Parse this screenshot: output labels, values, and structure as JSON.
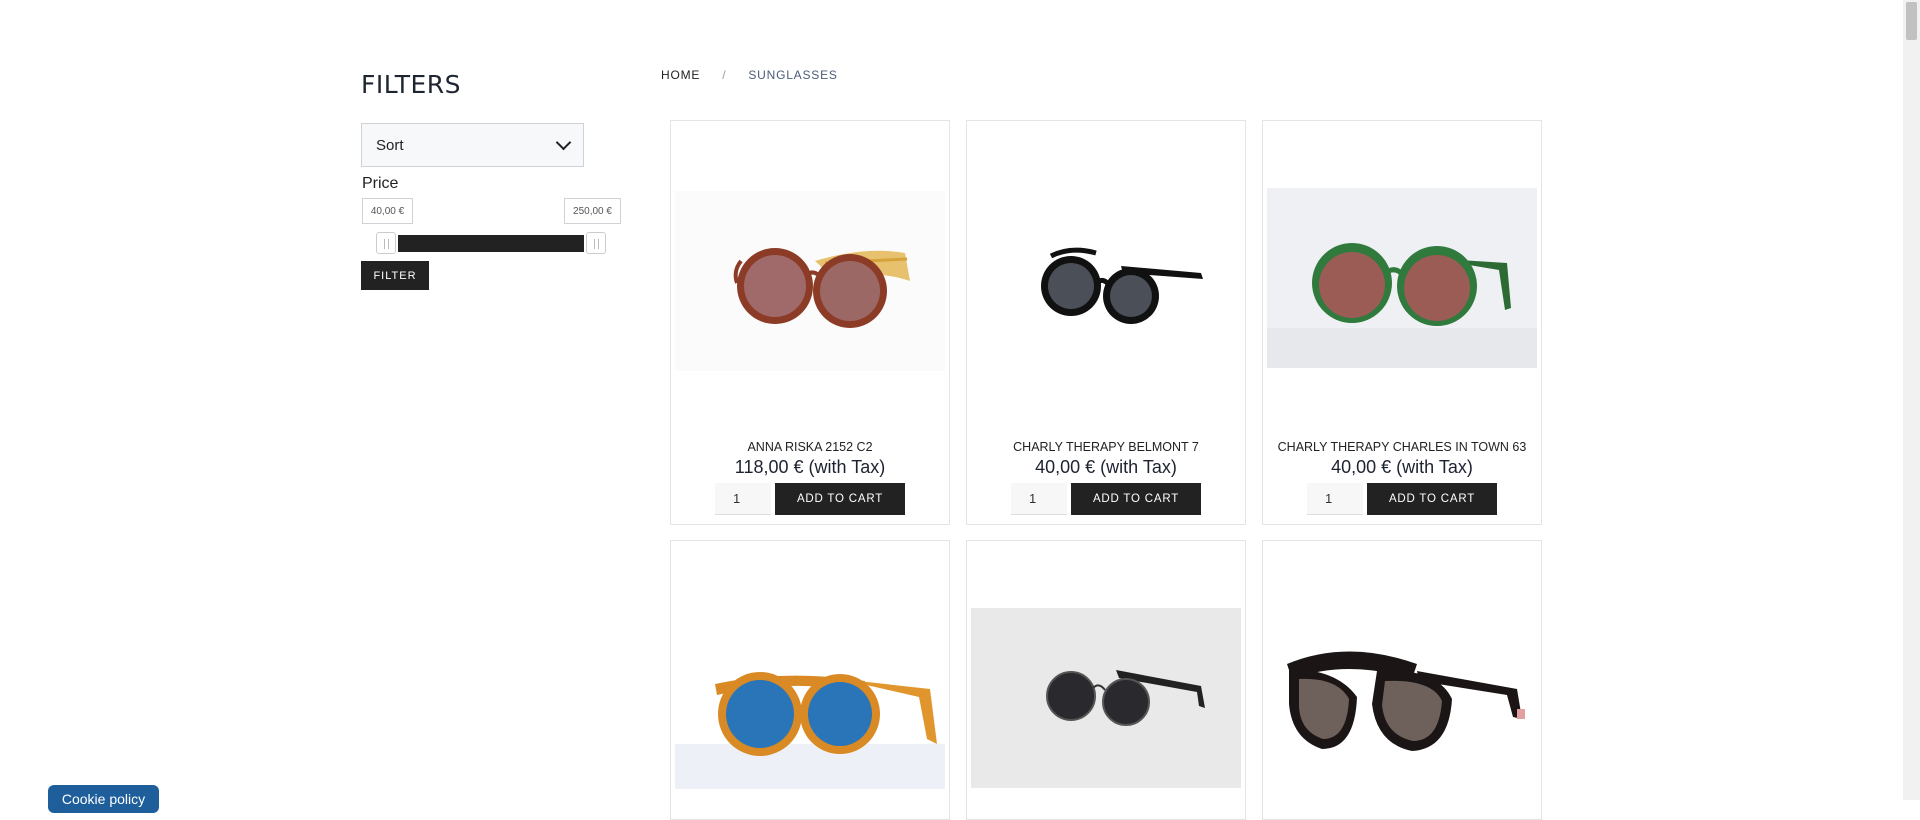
{
  "sidebar": {
    "title": "FILTERS",
    "sort": {
      "selected": "Sort"
    },
    "price_label": "Price",
    "price_min": "40,00 €",
    "price_max": "250,00 €",
    "filter_button": "FILTER"
  },
  "breadcrumb": {
    "home": "HOME",
    "separator": "/",
    "current": "SUNGLASSES"
  },
  "products": [
    {
      "name": "ANNA RISKA 2152 C2",
      "price": "118,00 € (with Tax)",
      "qty": "1",
      "cart": "ADD TO CART"
    },
    {
      "name": "CHARLY THERAPY BELMONT 7",
      "price": "40,00 € (with Tax)",
      "qty": "1",
      "cart": "ADD TO CART"
    },
    {
      "name": "CHARLY THERAPY CHARLES IN TOWN 63",
      "price": "40,00 € (with Tax)",
      "qty": "1",
      "cart": "ADD TO CART"
    }
  ],
  "cookie": {
    "label": "Cookie policy"
  },
  "colors": {
    "accent": "#222222",
    "cookie": "#1e5f9b",
    "breadcrumb_current": "#4b5c7a"
  }
}
